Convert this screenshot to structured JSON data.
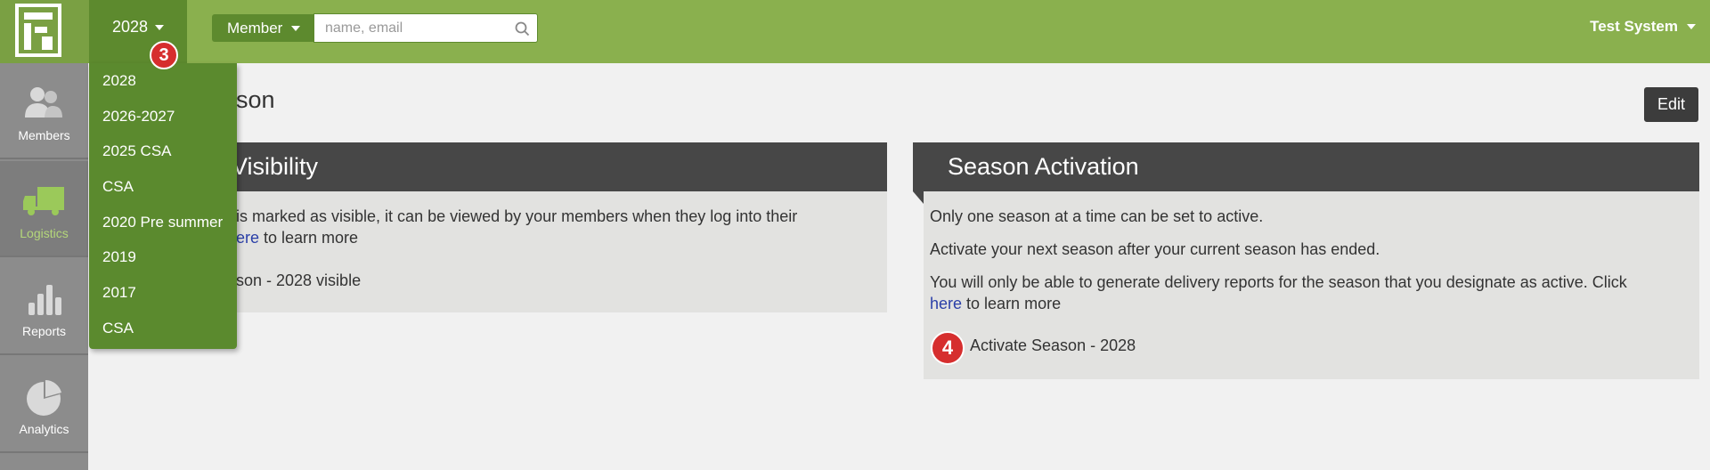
{
  "header": {
    "season_selected": "2028",
    "member_filter": "Member",
    "search_placeholder": "name, email",
    "user_name": "Test System"
  },
  "badges": {
    "dropdown_step": "3",
    "activate_step": "4"
  },
  "sidebar": {
    "items": [
      {
        "label": "Members",
        "icon": "members-icon"
      },
      {
        "label": "Logistics",
        "icon": "truck-icon",
        "active": true
      },
      {
        "label": "Reports",
        "icon": "bar-chart-icon"
      },
      {
        "label": "Analytics",
        "icon": "pie-chart-icon"
      }
    ]
  },
  "season_dropdown": {
    "options": [
      "2028",
      "2026-2027",
      "2025 CSA",
      "CSA",
      "2020 Pre summer",
      "2019",
      "2017",
      "CSA"
    ]
  },
  "main": {
    "title_visible": "ason",
    "edit_label": "Edit",
    "visibility": {
      "title_visible": "Visibility",
      "line1_visible": "is marked as visible, it can be viewed by your members when they log into their",
      "link_visible": "ere",
      "link_suffix": " to learn more",
      "action_visible": "son - 2028 visible"
    },
    "activation": {
      "title": "Season Activation",
      "line1": "Only one season at a time can be set to active.",
      "line2": "Activate your next season after your current season has ended.",
      "line3": "You will only be able to generate delivery reports for the season that you designate as active.  Click",
      "link": "here",
      "link_suffix": " to learn more",
      "action": "Activate Season - 2028"
    }
  },
  "colors": {
    "topbar": "#8ab04e",
    "dark_green": "#5d8a2e",
    "sidebar": "#8c8c8c",
    "panel_header": "#474747",
    "panel_body": "#e2e2e0",
    "badge_red": "#d62e2e",
    "link": "#2a3fa8"
  }
}
